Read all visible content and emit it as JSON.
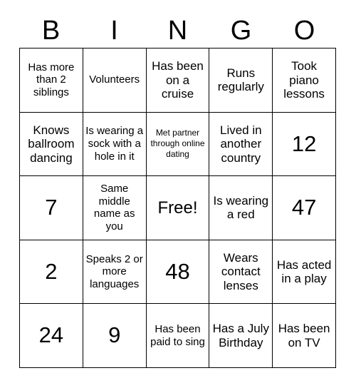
{
  "card": {
    "header_letters": [
      "B",
      "I",
      "N",
      "G",
      "O"
    ],
    "rows": [
      [
        {
          "text": "Has more than 2 siblings",
          "size": "sm"
        },
        {
          "text": "Volunteers",
          "size": "sm"
        },
        {
          "text": "Has been on a cruise",
          "size": "md"
        },
        {
          "text": "Runs regularly",
          "size": "md"
        },
        {
          "text": "Took piano lessons",
          "size": "md"
        }
      ],
      [
        {
          "text": "Knows ballroom dancing",
          "size": "md"
        },
        {
          "text": "Is wearing a sock with a hole in it",
          "size": "sm"
        },
        {
          "text": "Met partner through online dating",
          "size": "xs"
        },
        {
          "text": "Lived in another country",
          "size": "md"
        },
        {
          "text": "12",
          "size": "xl"
        }
      ],
      [
        {
          "text": "7",
          "size": "xl"
        },
        {
          "text": "Same middle name as you",
          "size": "sm"
        },
        {
          "text": "Free!",
          "size": "lg"
        },
        {
          "text": "Is wearing a red",
          "size": "md"
        },
        {
          "text": "47",
          "size": "xl"
        }
      ],
      [
        {
          "text": "2",
          "size": "xl"
        },
        {
          "text": "Speaks 2 or more languages",
          "size": "sm"
        },
        {
          "text": "48",
          "size": "xl"
        },
        {
          "text": "Wears contact lenses",
          "size": "md"
        },
        {
          "text": "Has acted in a play",
          "size": "md"
        }
      ],
      [
        {
          "text": "24",
          "size": "xl"
        },
        {
          "text": "9",
          "size": "xl"
        },
        {
          "text": "Has been paid to sing",
          "size": "sm"
        },
        {
          "text": "Has a July Birthday",
          "size": "md"
        },
        {
          "text": "Has been on TV",
          "size": "md"
        }
      ]
    ]
  },
  "colors": {
    "background": "#ffffff",
    "text": "#000000",
    "grid_line": "#000000"
  }
}
